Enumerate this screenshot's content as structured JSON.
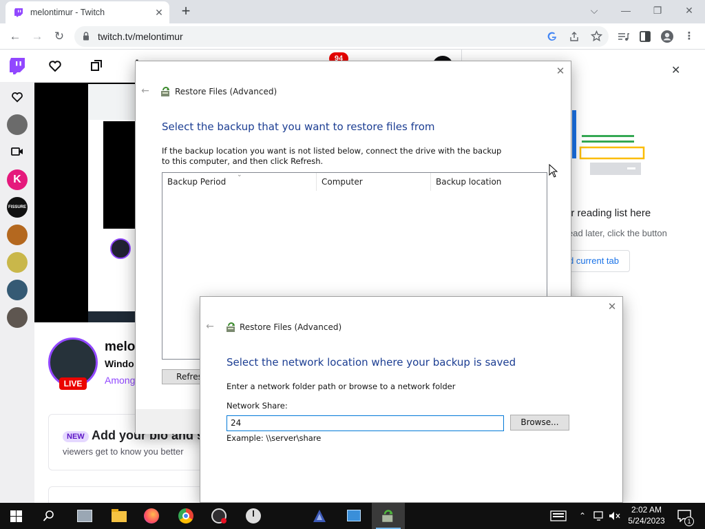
{
  "browser": {
    "tab_title": "melontimur - Twitch",
    "tab_close": "✕",
    "new_tab": "+",
    "url": "twitch.tv/melontimur",
    "window_controls": {
      "dropdown": "⌵",
      "minimize": "—",
      "restore": "❐",
      "close": "✕"
    }
  },
  "twitch": {
    "notification_count": "94",
    "channel_name": "melon",
    "stream_title": "Windo",
    "category": "Among",
    "live_label": "LIVE",
    "bio_card": {
      "new_badge": "NEW",
      "title": "Add your bio and s",
      "subtitle": "viewers get to know you better"
    }
  },
  "reading_list": {
    "close": "✕",
    "title": "ur reading list here",
    "description": "ead later, click the button",
    "add_button": "d current tab"
  },
  "dialog_backup": {
    "title": "Restore Files (Advanced)",
    "close": "✕",
    "heading": "Select the backup that you want to restore files from",
    "instruction": "If the backup location you want is not listed below, connect the drive with the backup to this computer, and then click Refresh.",
    "columns": [
      "Backup Period",
      "Computer",
      "Backup location"
    ],
    "refresh_button": "Refres"
  },
  "dialog_network": {
    "title": "Restore Files (Advanced)",
    "close": "✕",
    "heading": "Select the network location where your backup is saved",
    "instruction": "Enter a network folder path or browse to a network folder",
    "field_label": "Network Share:",
    "field_value": "24",
    "browse_button": "Browse...",
    "example": "Example: \\\\server\\share"
  },
  "taskbar": {
    "time": "2:02 AM",
    "date": "5/24/2023",
    "notification_count": "1",
    "accent": "#76b9ed"
  }
}
